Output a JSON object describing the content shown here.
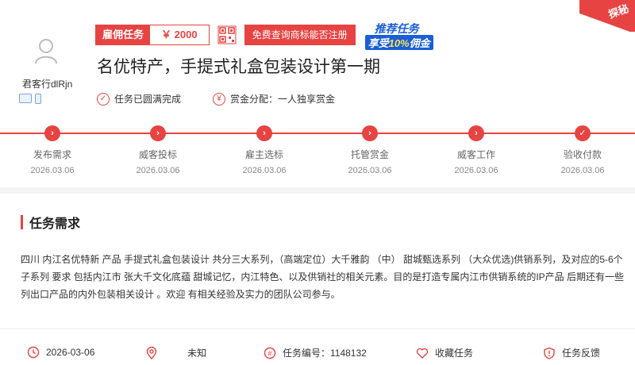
{
  "user": {
    "name": "君客行dlRjn"
  },
  "header": {
    "reward_label": "雇佣任务",
    "reward_amount": "￥ 2000",
    "trademark_button": "免费查询商标能否注册",
    "promo_line1": "推荐任务",
    "promo_line2_a": "享受",
    "promo_line2_b": "10%",
    "promo_line2_c": "佣金",
    "corner_label": "探秘"
  },
  "task": {
    "title": "名优特产，手提式礼盒包装设计第一期",
    "status": "任务已圆满完成",
    "reward_mode": "赏金分配：一人独享赏金"
  },
  "steps": [
    {
      "label": "发布需求",
      "date": "2026.03.06"
    },
    {
      "label": "威客投标",
      "date": "2026.03.06"
    },
    {
      "label": "雇主选标",
      "date": "2026.03.06"
    },
    {
      "label": "托管赏金",
      "date": "2026.03.06"
    },
    {
      "label": "威客工作",
      "date": "2026.03.06"
    },
    {
      "label": "验收付款",
      "date": "2026.03.06"
    }
  ],
  "section": {
    "title": "任务需求"
  },
  "description": "四川  内江名优特新  产品 手提式礼盒包装设计 共分三大系列，（高端定位）大千雅韵  （中）  甜城甄选系列  （大众优选)供销系列，及对应的5-6个子系列  要求  包括内江市  张大千文化底蕴  甜城记忆，内江特色、以及供销社的相关元素。目的是打造专属内江市供销系统的IP产品   后期还有一些列出口产品的内外包装相关设计 。欢迎 有相关经验及实力的团队公司参与。",
  "footer": {
    "date": "2026-03-06",
    "location": "未知",
    "task_no": "任务编号：1148132",
    "favorite": "收藏任务",
    "feedback": "任务反馈"
  }
}
